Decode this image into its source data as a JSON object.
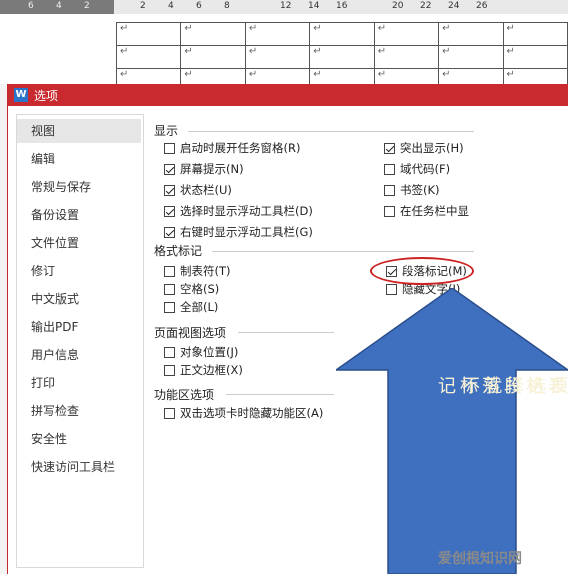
{
  "ruler": {
    "ticks": [
      "6",
      "4",
      "2",
      "",
      "2",
      "4",
      "6",
      "8",
      "",
      "12",
      "14",
      "16",
      "",
      "20",
      "22",
      "24",
      "26",
      ""
    ]
  },
  "doc": {
    "cell_mark": "↵"
  },
  "dialog": {
    "title": "选项",
    "app_icon": "W",
    "sidebar": [
      "视图",
      "编辑",
      "常规与保存",
      "备份设置",
      "文件位置",
      "修订",
      "中文版式",
      "输出PDF",
      "用户信息",
      "打印",
      "拼写检查",
      "安全性",
      "快速访问工具栏"
    ],
    "sections": {
      "display": {
        "title": "显示",
        "left": [
          {
            "label": "启动时展开任务窗格(R)",
            "checked": false
          },
          {
            "label": "屏幕提示(N)",
            "checked": true
          },
          {
            "label": "状态栏(U)",
            "checked": true
          },
          {
            "label": "选择时显示浮动工具栏(D)",
            "checked": true
          },
          {
            "label": "右键时显示浮动工具栏(G)",
            "checked": true
          }
        ],
        "right": [
          {
            "label": "突出显示(H)",
            "checked": true
          },
          {
            "label": "域代码(F)",
            "checked": false
          },
          {
            "label": "书签(K)",
            "checked": false
          },
          {
            "label": "在任务栏中显",
            "checked": false
          }
        ]
      },
      "format_marks": {
        "title": "格式标记",
        "left": [
          {
            "label": "制表符(T)",
            "checked": false
          },
          {
            "label": "空格(S)",
            "checked": false
          },
          {
            "label": "全部(L)",
            "checked": false
          }
        ],
        "right": [
          {
            "label": "段落标记(M)",
            "checked": true
          },
          {
            "label": "隐藏文字(I)",
            "checked": false
          }
        ]
      },
      "page_view": {
        "title": "页面视图选项",
        "left": [
          {
            "label": "对象位置(J)",
            "checked": false
          },
          {
            "label": "正文边框(X)",
            "checked": false
          }
        ]
      },
      "ribbon": {
        "title": "功能区选项",
        "left": [
          {
            "label": "双击选项卡时隐藏功能区(A)",
            "checked": false
          }
        ]
      }
    }
  },
  "annotation": {
    "lines": [
      "关闭这项选择就不",
      "显示表格段落标记"
    ],
    "arrow_color": "#3f6fbf",
    "highlight_color": "#cc2222"
  },
  "watermark": "爱创根知识网"
}
